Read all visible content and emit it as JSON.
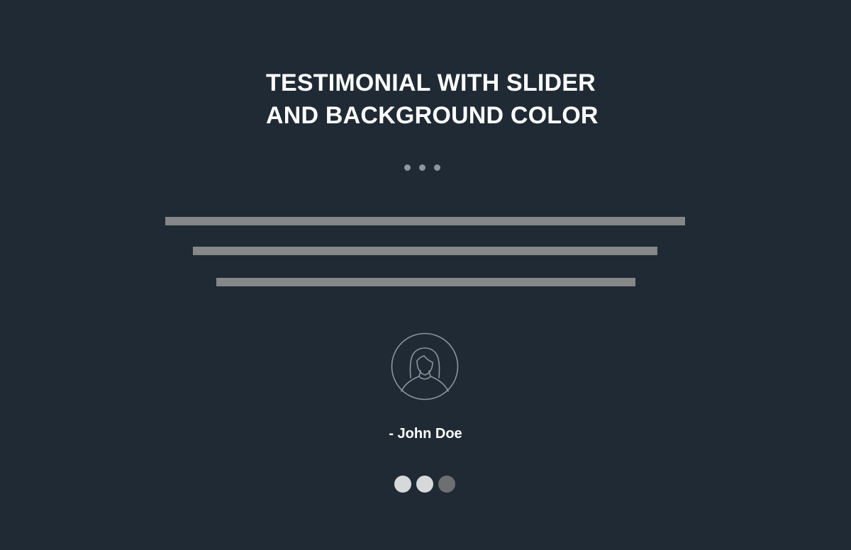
{
  "section": {
    "title_line_1": "TESTIMONIAL WITH SLIDER",
    "title_line_2": "AND BACKGROUND COLOR"
  },
  "testimonial": {
    "author": "- John Doe",
    "avatar_icon": "user-avatar-icon"
  },
  "slider": {
    "slide_count": 3,
    "active_index": 2
  },
  "colors": {
    "background": "#1f2a34",
    "text": "#ffffff",
    "placeholder_line": "#858788",
    "dot_active": "#6e6f71",
    "dot_inactive": "#d7d8d9"
  }
}
